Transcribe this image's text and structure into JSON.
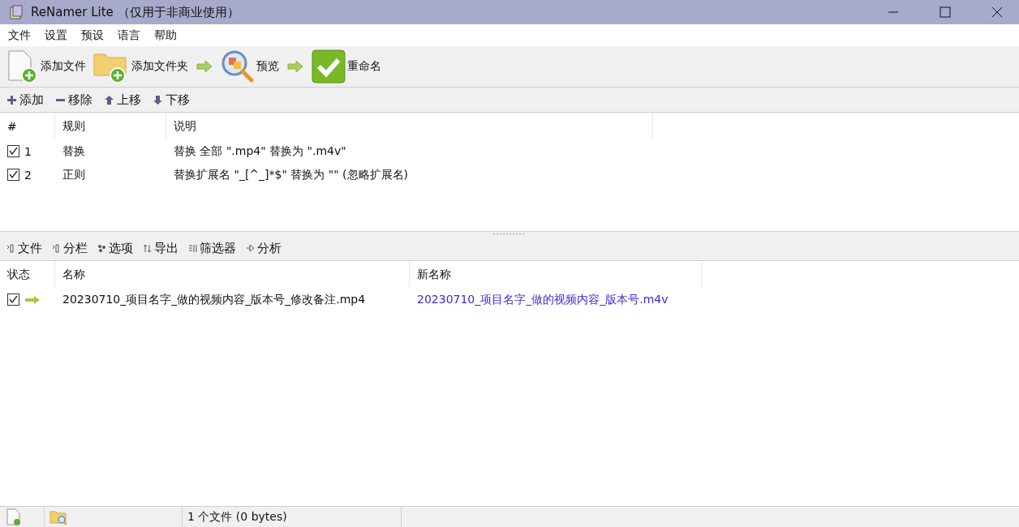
{
  "window": {
    "title": "ReNamer Lite （仅用于非商业使用）"
  },
  "menu": [
    "文件",
    "设置",
    "预设",
    "语言",
    "帮助"
  ],
  "toolbar": [
    {
      "kind": "add-files",
      "label": "添加文件"
    },
    {
      "kind": "add-folders",
      "label": "添加文件夹"
    },
    {
      "kind": "arrow"
    },
    {
      "kind": "preview",
      "label": "预览"
    },
    {
      "kind": "arrow"
    },
    {
      "kind": "rename",
      "label": "重命名"
    }
  ],
  "rules_toolbar": [
    {
      "kind": "plus",
      "label": "添加"
    },
    {
      "kind": "minus",
      "label": "移除"
    },
    {
      "kind": "up",
      "label": "上移"
    },
    {
      "kind": "down",
      "label": "下移"
    }
  ],
  "rules_table": {
    "columns": [
      "#",
      "规则",
      "说明"
    ],
    "rows": [
      {
        "checked": true,
        "index": "1",
        "rule": "替换",
        "description": "替换 全部 \".mp4\" 替换为 \".m4v\""
      },
      {
        "checked": true,
        "index": "2",
        "rule": "正则",
        "description": "替换扩展名 \"_[^_]*$\" 替换为 \"\" (忽略扩展名)"
      }
    ]
  },
  "files_toolbar": [
    {
      "kind": "columns",
      "label": "文件"
    },
    {
      "kind": "columns",
      "label": "分栏"
    },
    {
      "kind": "options",
      "label": "选项"
    },
    {
      "kind": "export",
      "label": "导出"
    },
    {
      "kind": "filter",
      "label": "筛选器"
    },
    {
      "kind": "analyze",
      "label": "分析"
    }
  ],
  "files_table": {
    "columns": [
      "状态",
      "名称",
      "新名称"
    ],
    "rows": [
      {
        "checked": true,
        "name": "20230710_项目名字_做的视频内容_版本号_修改备注.mp4",
        "new_name": "20230710_项目名字_做的视频内容_版本号.m4v"
      }
    ]
  },
  "status_bar": {
    "text": "1 个文件 (0 bytes)"
  }
}
